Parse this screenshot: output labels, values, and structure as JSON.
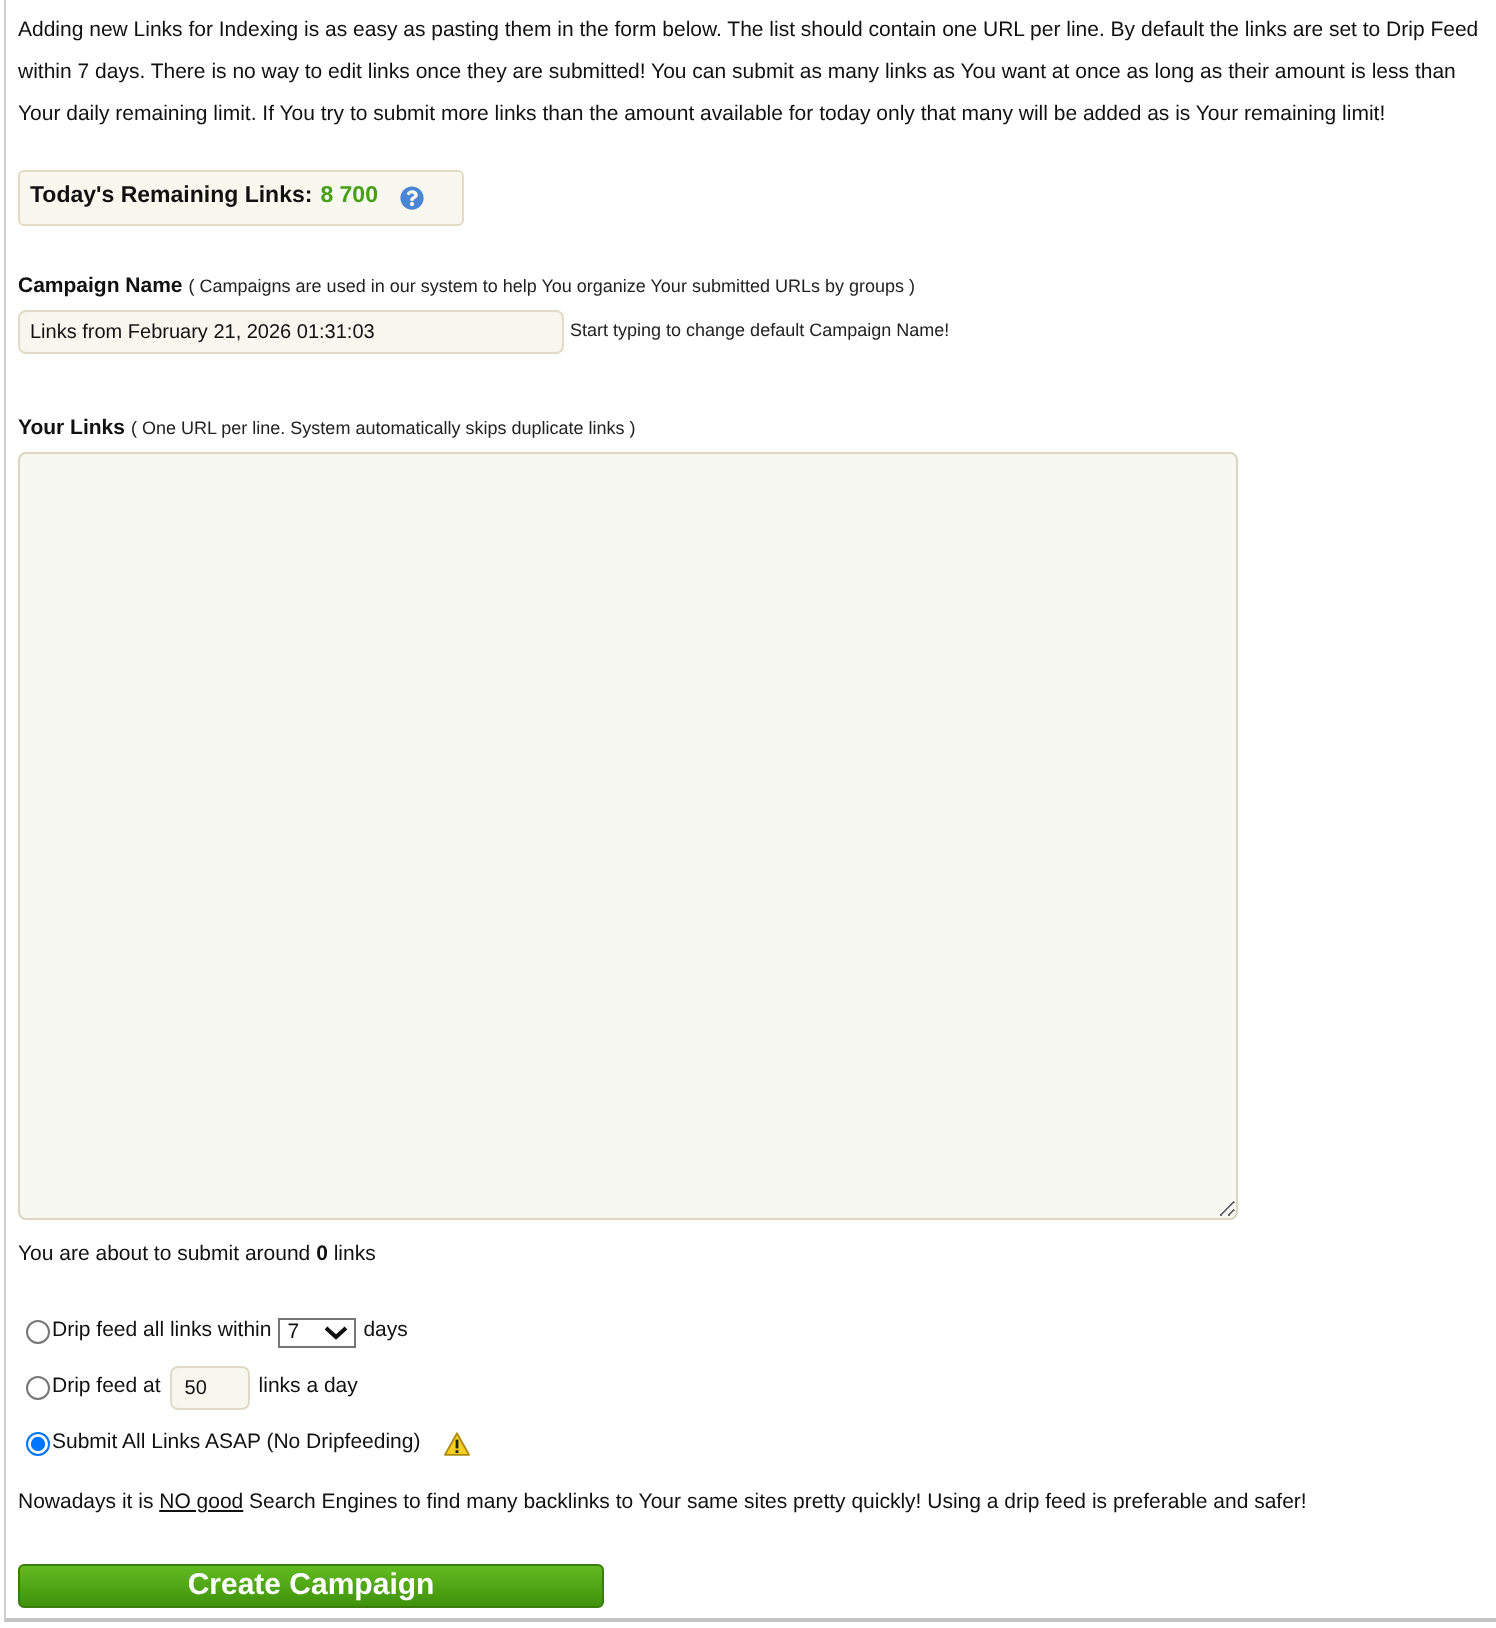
{
  "intro": "Adding new Links for Indexing is as easy as pasting them in the form below. The list should contain one URL per line. By default the links are set to Drip Feed within 7 days. There is no way to edit links once they are submitted! You can submit as many links as You want at once as long as their amount is less than Your daily remaining limit. If You try to submit more links than the amount available for today only that many will be added as is Your remaining limit!",
  "remaining": {
    "label": "Today's Remaining Links:",
    "value": "8 700"
  },
  "campaign_name": {
    "label": "Campaign Name",
    "hint": "( Campaigns are used in our system to help You organize Your submitted URLs by groups )",
    "value": "Links from February 21, 2026 01:31:03",
    "side_note": "Start typing to change default Campaign Name!"
  },
  "links": {
    "label": "Your Links",
    "hint": "( One URL per line. System automatically skips duplicate links )"
  },
  "count": "You are about to submit around **0** links",
  "options": [
    {
      "kind": "select",
      "selected": false,
      "before": "Drip feed all links within",
      "value": "7",
      "after": "days"
    },
    {
      "kind": "input",
      "selected": false,
      "before": "Drip feed at",
      "value": "50",
      "after": "links a day"
    },
    {
      "kind": "warning",
      "selected": true,
      "label": "Submit All Links ASAP (No Dripfeeding)"
    }
  ],
  "notice": {
    "before": "Nowadays it is ",
    "underlined": "NO good",
    "after": " Search Engines to find many backlinks to Your same sites pretty quickly! Using a drip feed is preferable and safer!"
  },
  "button": "Create Campaign"
}
